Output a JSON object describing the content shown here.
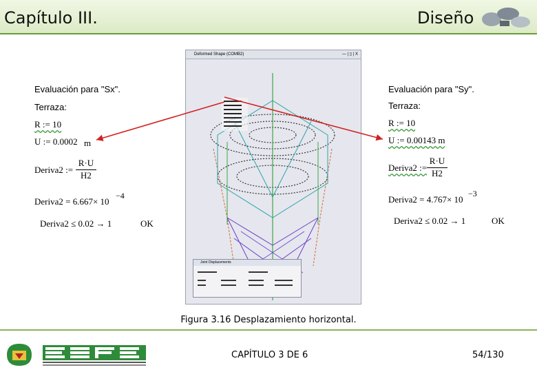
{
  "header": {
    "title_left": "Capítulo III.",
    "title_right": "Diseño"
  },
  "left": {
    "title": "Evaluación para \"Sx\".",
    "terraza": "Terraza:",
    "r_eq": "R := 10",
    "u_eq": "U := 0.0002",
    "u_unit": "m",
    "deriva_lhs": "Deriva2 :=",
    "deriva_num": "R·U",
    "deriva_den": "H2",
    "deriva_val": "Deriva2 = 6.667× 10",
    "deriva_exp": "−4",
    "check": "Deriva2 ≤ 0.02 → 1",
    "ok": "OK"
  },
  "right": {
    "title": "Evaluación para \"Sy\".",
    "terraza": "Terraza:",
    "r_eq": "R := 10",
    "u_eq": "U := 0.00143 m",
    "deriva_lhs": "Deriva2 :=",
    "deriva_num": "R·U",
    "deriva_den": "H2",
    "deriva_val": "Deriva2 = 4.767× 10",
    "deriva_exp": "−3",
    "check": "Deriva2 ≤ 0.02 → 1",
    "ok": "OK"
  },
  "screenshot": {
    "window_title": "Deformed Shape (COMB2)",
    "window_buttons": "— | ▯ | X",
    "dialog_title": "Joint Displacements"
  },
  "caption": "Figura 3.16 Desplazamiento horizontal.",
  "footer": {
    "center": "CAPÍTULO 3 DE 6",
    "page": "54/130",
    "logo_text": "ESPE"
  },
  "colors": {
    "header_bg": "#dcebc6",
    "accent_green": "#6a9a3a",
    "arrow_red": "#d22020",
    "logo_green": "#2e8b3a"
  }
}
